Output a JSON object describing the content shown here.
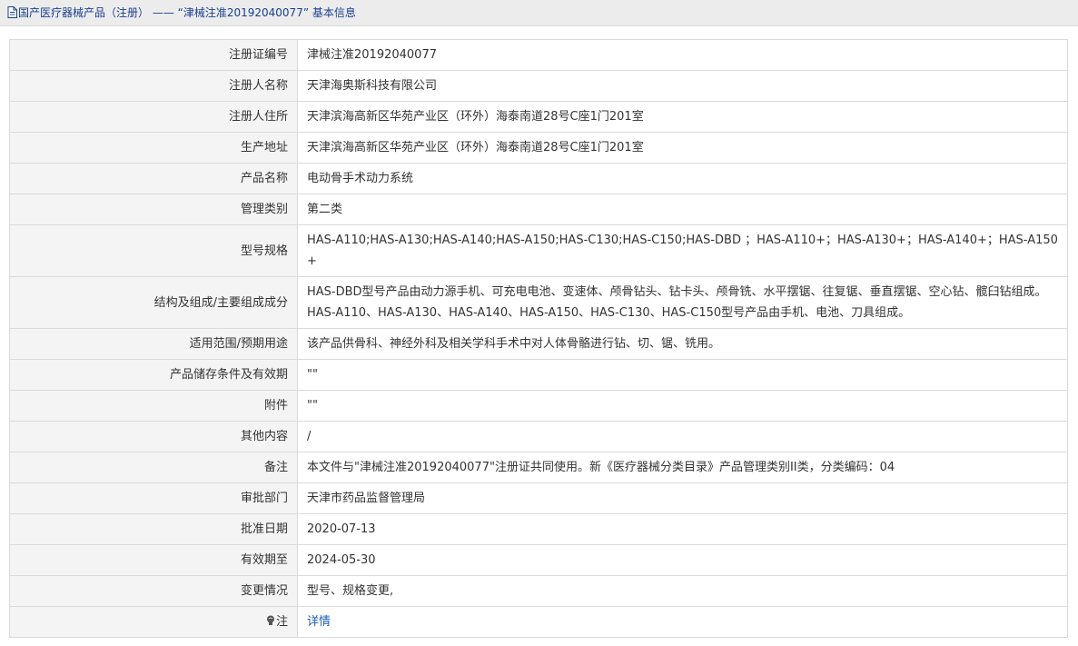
{
  "header": {
    "title": "国产医疗器械产品（注册） —— “津械注准20192040077” 基本信息"
  },
  "rows": [
    {
      "label": "注册证编号",
      "value": "津械注准20192040077"
    },
    {
      "label": "注册人名称",
      "value": "天津海奥斯科技有限公司"
    },
    {
      "label": "注册人住所",
      "value": "天津滨海高新区华苑产业区（环外）海泰南道28号C座1门201室"
    },
    {
      "label": "生产地址",
      "value": "天津滨海高新区华苑产业区（环外）海泰南道28号C座1门201室"
    },
    {
      "label": "产品名称",
      "value": "电动骨手术动力系统"
    },
    {
      "label": "管理类别",
      "value": "第二类"
    },
    {
      "label": "型号规格",
      "value": "HAS-A110;HAS-A130;HAS-A140;HAS-A150;HAS-C130;HAS-C150;HAS-DBD ；HAS-A110+；HAS-A130+；HAS-A140+；HAS-A150+"
    },
    {
      "label": "结构及组成/主要组成成分",
      "value": "HAS-DBD型号产品由动力源手机、可充电电池、变速体、颅骨钻头、钻卡头、颅骨铣、水平摆锯、往复锯、垂直摆锯、空心钻、髋臼钻组成。 HAS-A110、HAS-A130、HAS-A140、HAS-A150、HAS-C130、HAS-C150型号产品由手机、电池、刀具组成。"
    },
    {
      "label": "适用范围/预期用途",
      "value": "该产品供骨科、神经外科及相关学科手术中对人体骨骼进行钻、切、锯、铣用。"
    },
    {
      "label": "产品储存条件及有效期",
      "value": "\"\""
    },
    {
      "label": "附件",
      "value": "\"\""
    },
    {
      "label": "其他内容",
      "value": "/"
    },
    {
      "label": "备注",
      "value": "本文件与\"津械注准20192040077\"注册证共同使用。新《医疗器械分类目录》产品管理类别II类，分类编码：04"
    },
    {
      "label": "审批部门",
      "value": "天津市药品监督管理局"
    },
    {
      "label": "批准日期",
      "value": "2020-07-13"
    },
    {
      "label": "有效期至",
      "value": "2024-05-30"
    },
    {
      "label": "变更情况",
      "value": "型号、规格变更,"
    }
  ],
  "note_row": {
    "label": "注",
    "link_text": "详情",
    "icon": "lightbulb-icon"
  },
  "colors": {
    "title_text": "#1a3f8e",
    "label_bg": "#f4f4f4",
    "border": "#dadada",
    "link": "#1a5fb4"
  }
}
